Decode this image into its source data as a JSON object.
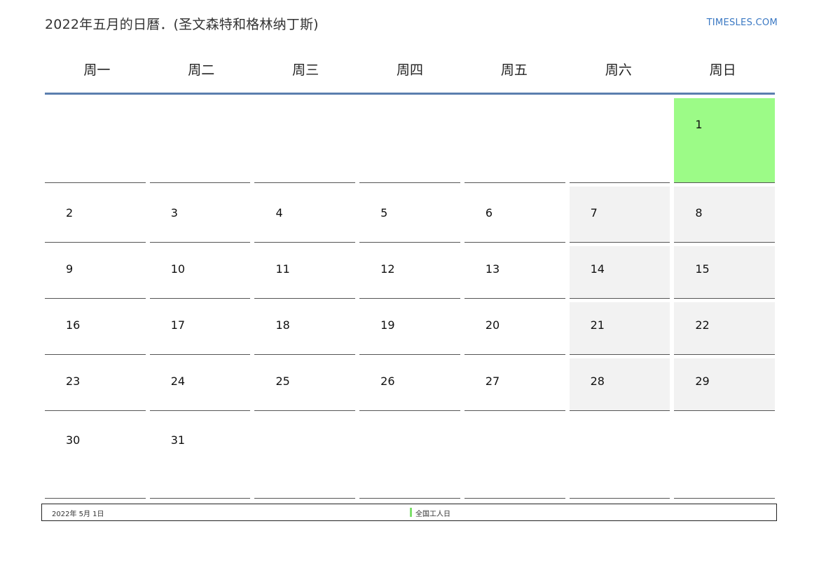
{
  "header": {
    "title": "2022年五月的日曆．(圣文森特和格林纳丁斯)",
    "site": "TIMESLES.COM"
  },
  "weekdays": [
    "周一",
    "周二",
    "周三",
    "周四",
    "周五",
    "周六",
    "周日"
  ],
  "weeks": [
    [
      "",
      "",
      "",
      "",
      "",
      "",
      "1"
    ],
    [
      "2",
      "3",
      "4",
      "5",
      "6",
      "7",
      "8"
    ],
    [
      "9",
      "10",
      "11",
      "12",
      "13",
      "14",
      "15"
    ],
    [
      "16",
      "17",
      "18",
      "19",
      "20",
      "21",
      "22"
    ],
    [
      "23",
      "24",
      "25",
      "26",
      "27",
      "28",
      "29"
    ],
    [
      "30",
      "31",
      "",
      "",
      "",
      "",
      ""
    ]
  ],
  "highlight": {
    "color": "#9cfb87",
    "weekend_color": "#f2f2f2"
  },
  "footer": {
    "date": "2022年 5月 1日",
    "holiday": "全国工人日"
  }
}
